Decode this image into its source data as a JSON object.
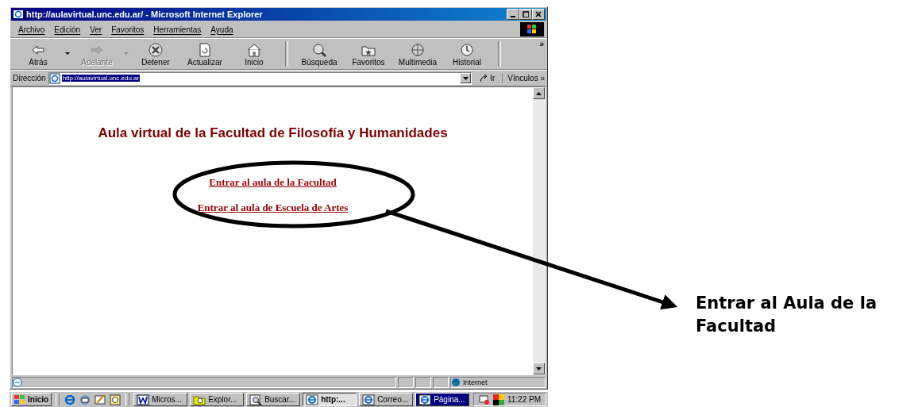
{
  "window": {
    "title": "http://aulavirtual.unc.edu.ar/ - Microsoft Internet Explorer"
  },
  "menu": [
    "Archivo",
    "Edición",
    "Ver",
    "Favoritos",
    "Herramientas",
    "Ayuda"
  ],
  "toolbar": {
    "buttons": [
      {
        "label": "Atrás",
        "kind": "back",
        "disabled": false,
        "dropdown": true,
        "separator_before": false
      },
      {
        "label": "Adelante",
        "kind": "forward",
        "disabled": true,
        "dropdown": true,
        "separator_before": false
      },
      {
        "label": "Detener",
        "kind": "stop",
        "disabled": false,
        "dropdown": false,
        "separator_before": false
      },
      {
        "label": "Actualizar",
        "kind": "refresh",
        "disabled": false,
        "dropdown": false,
        "separator_before": false
      },
      {
        "label": "Inicio",
        "kind": "home",
        "disabled": false,
        "dropdown": false,
        "separator_before": false
      },
      {
        "label": "Búsqueda",
        "kind": "search",
        "disabled": false,
        "dropdown": false,
        "separator_before": true
      },
      {
        "label": "Favoritos",
        "kind": "favorites",
        "disabled": false,
        "dropdown": false,
        "separator_before": false
      },
      {
        "label": "Multimedia",
        "kind": "media",
        "disabled": false,
        "dropdown": false,
        "separator_before": false
      },
      {
        "label": "Historial",
        "kind": "history",
        "disabled": false,
        "dropdown": false,
        "separator_before": false
      }
    ],
    "more": "»"
  },
  "address": {
    "label": "Dirección",
    "value": "http://aulavirtual.unc.edu.ar",
    "go": "Ir",
    "links": "Vínculos",
    "more": "»"
  },
  "page": {
    "heading": "Aula virtual de la Facultad de Filosofía y Humanidades",
    "links": [
      "Entrar al aula de la Facultad",
      "Entrar al aula de Escuela de Artes"
    ]
  },
  "status_bar": {
    "zone": "Internet"
  },
  "taskbar": {
    "start": "Inicio",
    "tasks": [
      {
        "label": "Micros...",
        "kind": "word",
        "selected": false,
        "highlighted": false
      },
      {
        "label": "Explor...",
        "kind": "folder",
        "selected": false,
        "highlighted": false
      },
      {
        "label": "Buscar...",
        "kind": "search",
        "selected": false,
        "highlighted": false
      },
      {
        "label": "http:...",
        "kind": "ie",
        "selected": true,
        "highlighted": false
      },
      {
        "label": "Correo...",
        "kind": "ie",
        "selected": false,
        "highlighted": false
      },
      {
        "label": "Página...",
        "kind": "ie",
        "selected": false,
        "highlighted": true
      }
    ],
    "clock": "11:22 PM"
  },
  "annotation": {
    "callout": "Entrar al Aula de la Facultad"
  }
}
